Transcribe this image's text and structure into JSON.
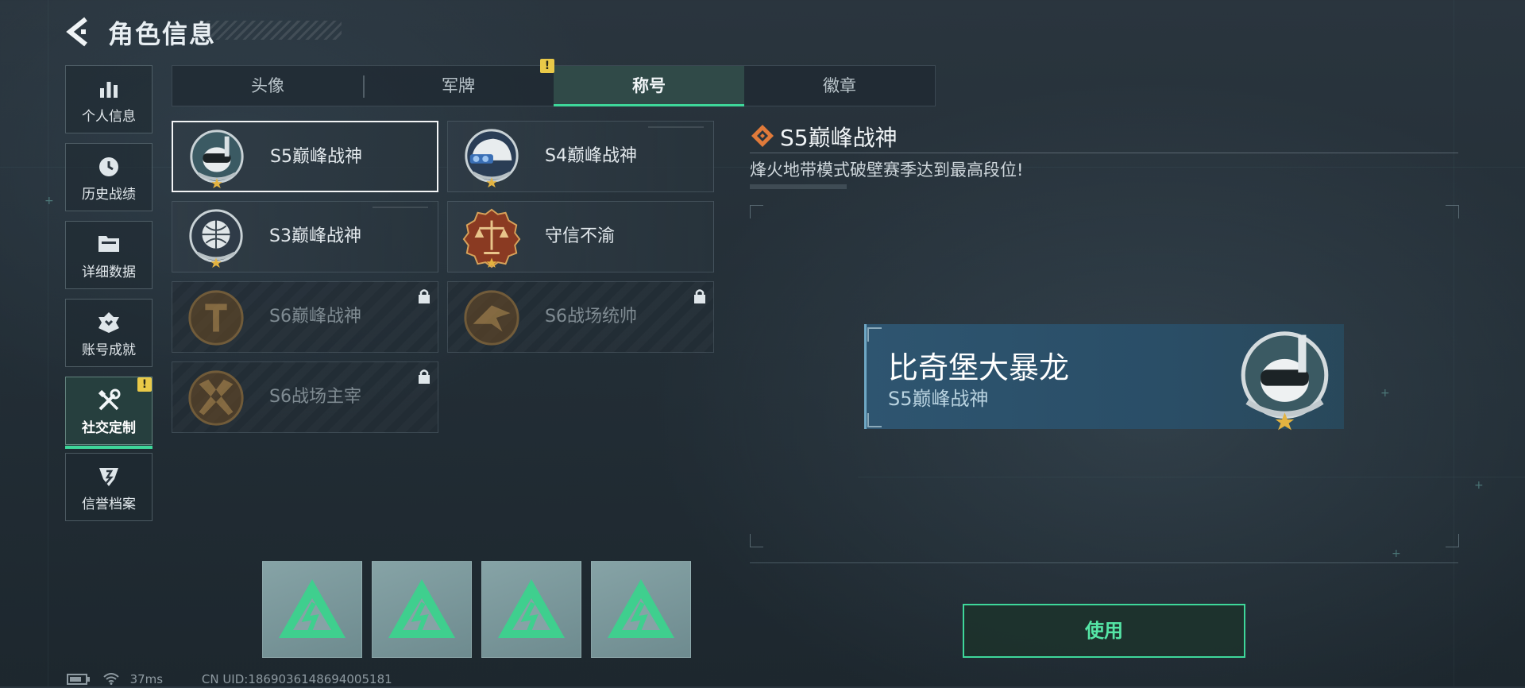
{
  "header": {
    "title": "角色信息",
    "back_icon": "back-arrow-icon"
  },
  "nav": {
    "items": [
      {
        "label": "个人信息",
        "icon": "bar-chart-icon"
      },
      {
        "label": "历史战绩",
        "icon": "history-clock-icon"
      },
      {
        "label": "详细数据",
        "icon": "folder-icon"
      },
      {
        "label": "账号成就",
        "icon": "achievement-icon"
      },
      {
        "label": "社交定制",
        "icon": "wrench-screwdriver-icon",
        "active": true,
        "badge": "!"
      },
      {
        "label": "信誉档案",
        "icon": "reputation-icon"
      }
    ]
  },
  "tabs": {
    "items": [
      {
        "label": "头像"
      },
      {
        "label": "军牌",
        "badge": "!"
      },
      {
        "label": "称号",
        "active": true
      },
      {
        "label": "徽章"
      }
    ]
  },
  "titles": {
    "items": [
      {
        "name": "S5巅峰战神",
        "selected": true,
        "locked": false
      },
      {
        "name": "S4巅峰战神",
        "selected": false,
        "locked": false
      },
      {
        "name": "S3巅峰战神",
        "selected": false,
        "locked": false
      },
      {
        "name": "守信不渝",
        "selected": false,
        "locked": false
      },
      {
        "name": "S6巅峰战神",
        "selected": false,
        "locked": true
      },
      {
        "name": "S6战场统帅",
        "selected": false,
        "locked": true
      },
      {
        "name": "S6战场主宰",
        "selected": false,
        "locked": true
      }
    ]
  },
  "detail": {
    "title": "S5巅峰战神",
    "description": "烽火地带模式破壁赛季达到最高段位!"
  },
  "preview": {
    "player_name": "比奇堡大暴龙",
    "title": "S5巅峰战神"
  },
  "use_button": {
    "label": "使用"
  },
  "slots": {
    "count": 4,
    "icon": "delta-triangle-icon"
  },
  "status": {
    "ping": "37ms",
    "uid": "CN UID:1869036148694005181"
  },
  "colors": {
    "accent": "#3ed79a",
    "warning": "#e9c948",
    "preview_bg": "#2e5570"
  }
}
